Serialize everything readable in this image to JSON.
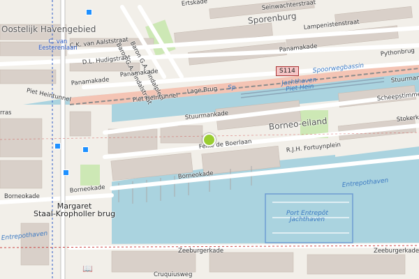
{
  "areas": {
    "oostelijk_havengebied": "Oostelijk Havengebied",
    "sporenburg": "Sporenburg",
    "borneo_eiland": "Borneo-eiland"
  },
  "streets": {
    "ertskade": "Ertskade",
    "seinwachterstraat": "Seinwachterstraat",
    "lampenistenstraat": "Lampenistenstraat",
    "panamakade_top": "Panamakade",
    "pythonbrug": "Pythonbrug",
    "baron_tindalplein": "Baron G.A. Tindalplein",
    "baron_tindalstraat": "Baron G.A. Tindalstraat",
    "ckvan": "C.K. van Aalststraat",
    "hudig": "D.L. Hudigstraat",
    "panamakade_left": "Panamakade",
    "panamakade_mid": "Panamakade",
    "piet_heintunnel_left": "Piet Heintunnel",
    "piet_heintunnel_main": "Piet Heintunnel",
    "lage_brug": "Lage Brug",
    "stuurmankade_right": "Stuurmankade",
    "stuurmankade_mid": "Stuurmankade",
    "scheepstimmerman": "Scheepstimmer",
    "stokerkade": "Stokerk",
    "feike": "Feike de Boerlaan",
    "fortuyn": "R.J.H. Fortuynplein",
    "borneokade_mid": "Borneokade",
    "borneokade_left": "Borneokade",
    "zeeburgerkade_left": "Zeeburgerkade",
    "zeeburgerkade_right": "Zeeburgerkade",
    "cruquiusweg": "Cruquiusweg",
    "terras": "rras"
  },
  "water": {
    "spoorwegbassin": "Spoorwegbassin",
    "jachthaven_piet_hein": "Jachthaven\nPiet Hein",
    "entrepothaven_right": "Entrepothaven",
    "entrepothaven_left": "Entrepothaven",
    "port_entrepot": "Port Entrepôt\nJachthaven"
  },
  "stations": {
    "c_van_eesteren": "C. van\nEesterenlaan"
  },
  "bridge": {
    "margaret_staal": "Margaret\nStaal-Kropholler brug"
  },
  "road_shield": "S114",
  "sp": "Sp",
  "colors": {
    "water": "#aad3df",
    "land": "#f2efe9",
    "building": "#d9d0c9",
    "tunnel": "#f4c4b4",
    "marker": "#9acd32"
  }
}
